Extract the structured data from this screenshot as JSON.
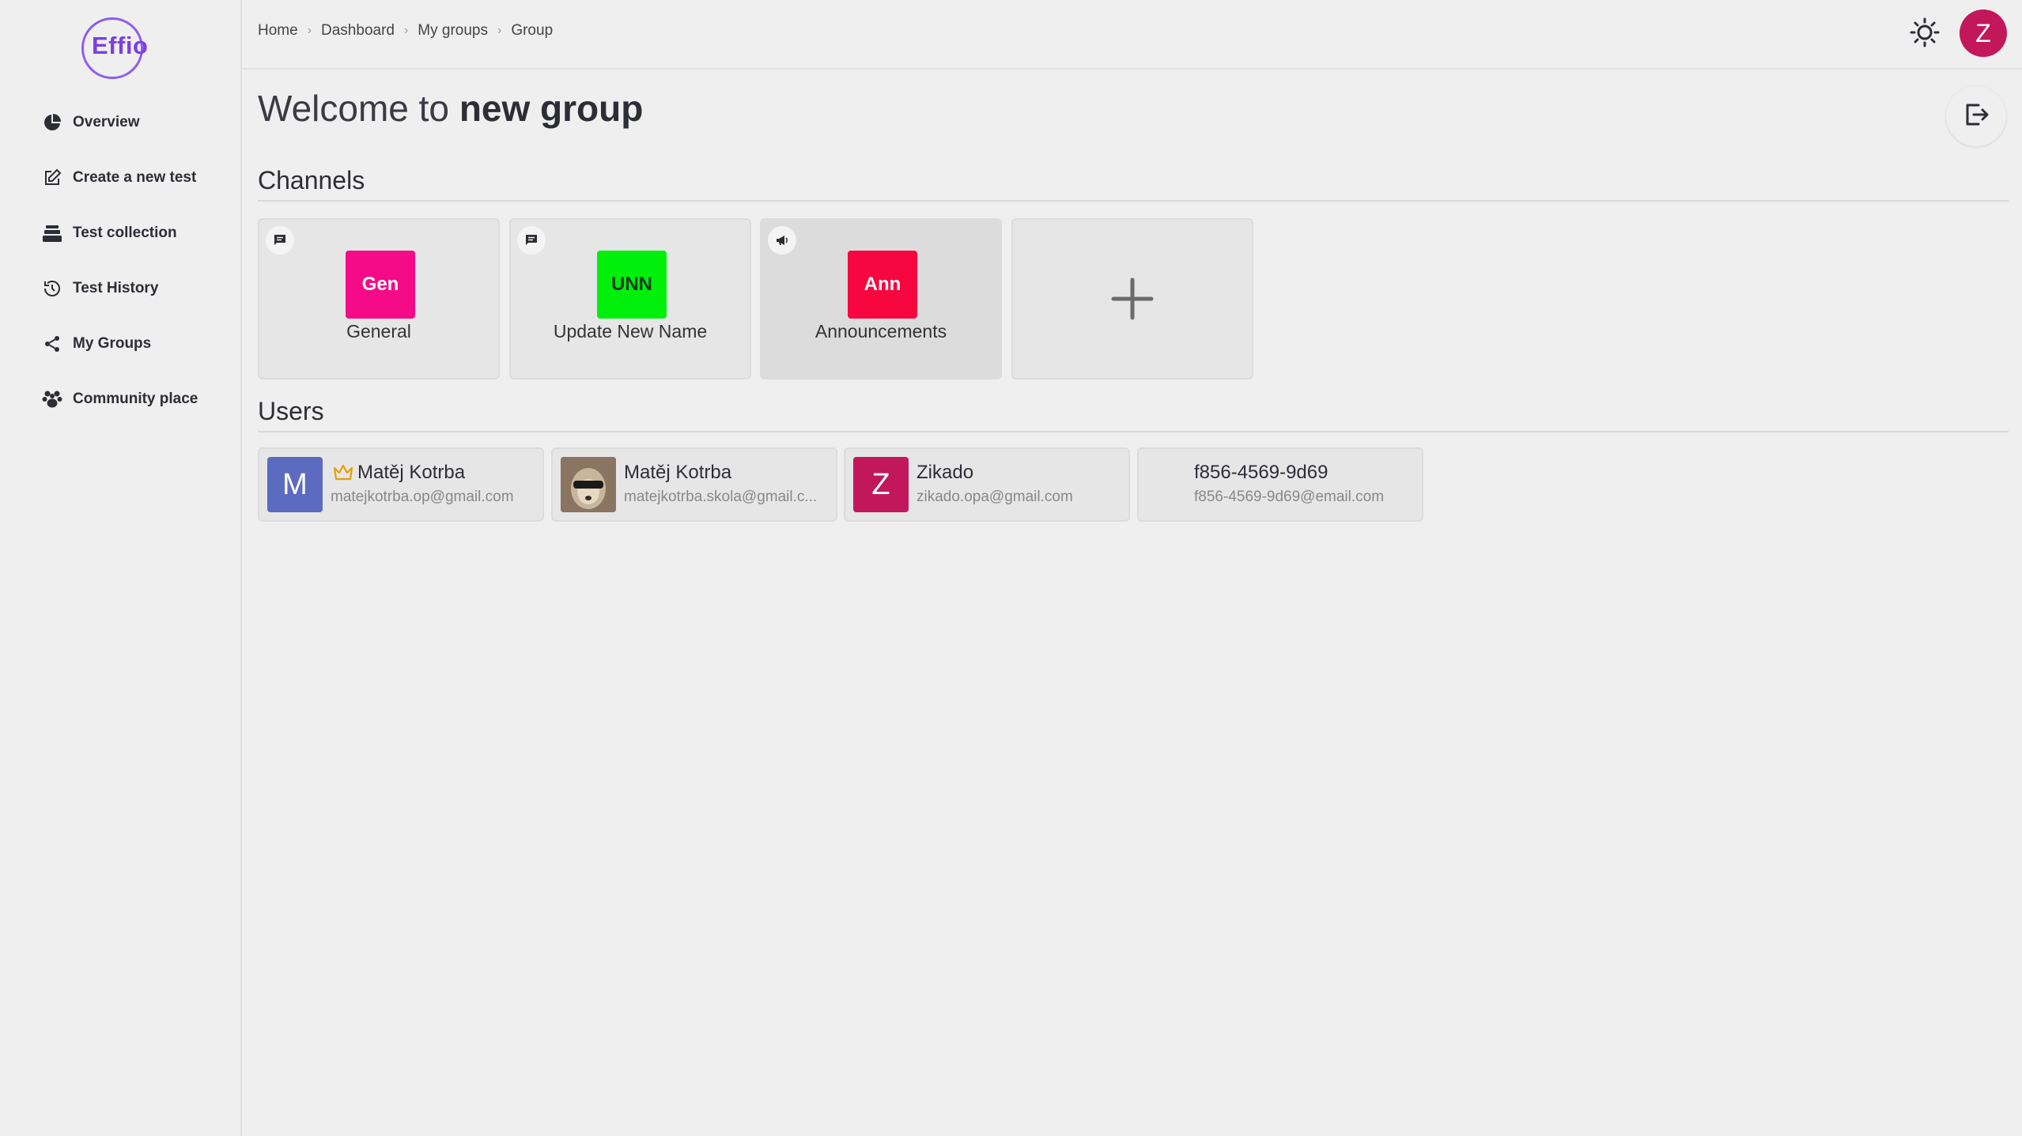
{
  "app": {
    "logo": "Effio"
  },
  "sidebar": {
    "items": [
      {
        "label": "Overview",
        "icon": "pie-chart-icon"
      },
      {
        "label": "Create a new test",
        "icon": "edit-icon"
      },
      {
        "label": "Test collection",
        "icon": "stack-icon"
      },
      {
        "label": "Test History",
        "icon": "history-icon"
      },
      {
        "label": "My Groups",
        "icon": "share-icon"
      },
      {
        "label": "Community place",
        "icon": "paw-icon"
      }
    ]
  },
  "header": {
    "breadcrumb": [
      "Home",
      "Dashboard",
      "My groups",
      "Group"
    ],
    "theme_icon": "sun-icon",
    "user_initial": "Z",
    "user_avatar_color": "#c2185b"
  },
  "main": {
    "welcome_prefix": "Welcome to",
    "group_name": "new group",
    "channels_title": "Channels",
    "users_title": "Users",
    "channels": [
      {
        "abbr": "Gen",
        "name": "General",
        "color": "#f50a87",
        "text_color": "#ffffff",
        "icon": "chat-icon"
      },
      {
        "abbr": "UNN",
        "name": "Update New Name",
        "color": "#00f00c",
        "text_color": "#1d3a1d",
        "icon": "chat-icon"
      },
      {
        "abbr": "Ann",
        "name": "Announcements",
        "color": "#f7063f",
        "text_color": "#ffffff",
        "icon": "megaphone-icon"
      }
    ],
    "add_channel_icon": "plus-icon",
    "users": [
      {
        "initial": "M",
        "name": "Matěj Kotrba",
        "email": "matejkotrba.op@gmail.com",
        "avatar_color": "#5c6bc0",
        "owner": true
      },
      {
        "initial": "",
        "name": "Matěj Kotrba",
        "email": "matejkotrba.skola@gmail.c...",
        "avatar_color": "#6d5a4a",
        "owner": false
      },
      {
        "initial": "Z",
        "name": "Zikado",
        "email": "zikado.opa@gmail.com",
        "avatar_color": "#c2185b",
        "owner": false
      },
      {
        "initial": "",
        "name": "f856-4569-9d69",
        "email": "f856-4569-9d69@email.com",
        "avatar_color": "",
        "owner": false
      }
    ]
  }
}
